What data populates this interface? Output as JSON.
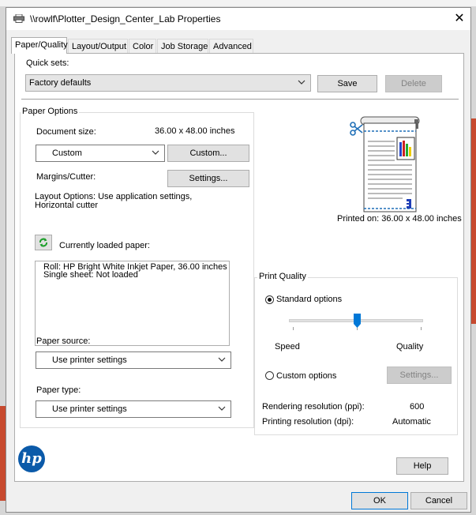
{
  "window": {
    "title": "\\\\rowlf\\Plotter_Design_Center_Lab Properties",
    "close_label": "✕"
  },
  "tabs": [
    {
      "label": "Paper/Quality",
      "active": true
    },
    {
      "label": "Layout/Output",
      "active": false
    },
    {
      "label": "Color",
      "active": false
    },
    {
      "label": "Job Storage",
      "active": false
    },
    {
      "label": "Advanced",
      "active": false
    }
  ],
  "quick_sets": {
    "label": "Quick sets:",
    "value": "Factory defaults",
    "save_label": "Save",
    "delete_label": "Delete"
  },
  "paper_options": {
    "group_title": "Paper Options",
    "document_size_label": "Document size:",
    "document_size_value": "36.00 x 48.00 inches",
    "size_select_value": "Custom",
    "custom_button": "Custom...",
    "margins_label": "Margins/Cutter:",
    "settings_button": "Settings...",
    "layout_options_text": "Layout Options: Use application settings, Horizontal cutter",
    "loaded_paper_label": "Currently loaded paper:",
    "loaded_paper_lines": [
      "Roll: HP Bright White Inkjet Paper, 36.00 inches",
      "Single sheet: Not loaded"
    ],
    "paper_source_label": "Paper source:",
    "paper_source_value": "Use printer settings",
    "paper_type_label": "Paper type:",
    "paper_type_value": "Use printer settings"
  },
  "preview": {
    "printed_on": "Printed on: 36.00 x 48.00 inches"
  },
  "print_quality": {
    "group_title": "Print Quality",
    "standard_label": "Standard options",
    "standard_selected": true,
    "speed_label": "Speed",
    "quality_label": "Quality",
    "slider_level": 0.5,
    "custom_label": "Custom options",
    "custom_selected": false,
    "custom_settings_button": "Settings...",
    "rendering_label": "Rendering resolution (ppi):",
    "rendering_value": "600",
    "printing_label": "Printing resolution (dpi):",
    "printing_value": "Automatic"
  },
  "footer": {
    "logo_text": "hp",
    "help_label": "Help",
    "ok_label": "OK",
    "cancel_label": "Cancel"
  },
  "colors": {
    "accent": "#0078d7",
    "hp_blue": "#0b5aa9",
    "background_app_red": "#c74a2f"
  }
}
